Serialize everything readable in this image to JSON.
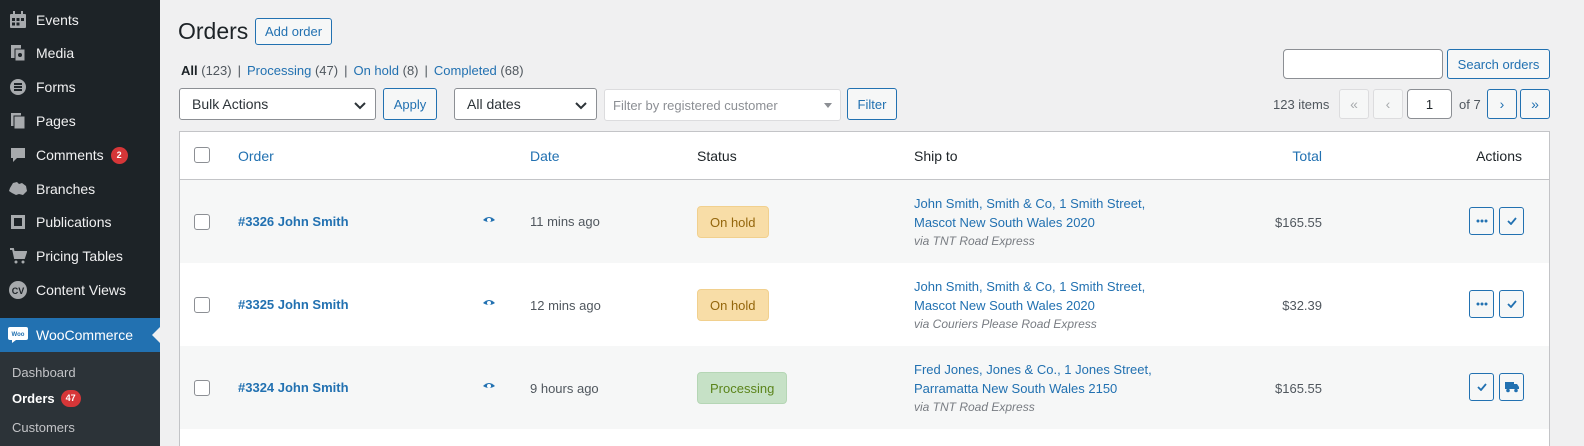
{
  "sidebar": {
    "items": [
      {
        "label": "Events",
        "icon": "calendar-icon"
      },
      {
        "label": "Media",
        "icon": "media-icon"
      },
      {
        "label": "Forms",
        "icon": "forms-icon"
      },
      {
        "label": "Pages",
        "icon": "pages-icon"
      },
      {
        "label": "Comments",
        "icon": "comments-icon",
        "badge": "2"
      },
      {
        "label": "Branches",
        "icon": "map-icon"
      },
      {
        "label": "Publications",
        "icon": "publications-icon"
      },
      {
        "label": "Pricing Tables",
        "icon": "cart-icon"
      },
      {
        "label": "Content Views",
        "icon": "cv-icon"
      }
    ],
    "woocommerce": {
      "label": "WooCommerce",
      "icon_text": "Woo"
    },
    "submenu": [
      {
        "label": "Dashboard"
      },
      {
        "label": "Orders",
        "badge": "47"
      },
      {
        "label": "Customers"
      }
    ]
  },
  "header": {
    "title": "Orders",
    "add_label": "Add order"
  },
  "views": [
    {
      "label": "All",
      "count": "(123)"
    },
    {
      "label": "Processing",
      "count": "(47)"
    },
    {
      "label": "On hold",
      "count": "(8)"
    },
    {
      "label": "Completed",
      "count": "(68)"
    }
  ],
  "filters": {
    "bulk_actions": "Bulk Actions",
    "apply_label": "Apply",
    "dates": "All dates",
    "customer_placeholder": "Filter by registered customer",
    "filter_label": "Filter"
  },
  "search": {
    "button_label": "Search orders"
  },
  "pagination": {
    "items": "123 items",
    "first": "«",
    "prev": "‹",
    "current": "1",
    "of": "of 7",
    "next": "›",
    "last": "»"
  },
  "table": {
    "headers": {
      "order": "Order",
      "date": "Date",
      "status": "Status",
      "ship_to": "Ship to",
      "total": "Total",
      "actions": "Actions"
    },
    "rows": [
      {
        "order": "#3326 John Smith",
        "date": "11 mins ago",
        "status": "On hold",
        "ship_line1": "John Smith, Smith & Co, 1 Smith Street,",
        "ship_line2": "Mascot New South Wales 2020",
        "via": "via TNT Road Express",
        "total": "$165.55"
      },
      {
        "order": "#3325 John Smith",
        "date": "12 mins ago",
        "status": "On hold",
        "ship_line1": "John Smith, Smith & Co, 1 Smith Street,",
        "ship_line2": "Mascot New South Wales 2020",
        "via": "via Couriers Please Road Express",
        "total": "$32.39"
      },
      {
        "order": "#3324 John Smith",
        "date": "9 hours ago",
        "status": "Processing",
        "ship_line1": "Fred Jones, Jones & Co., 1 Jones Street,",
        "ship_line2": "Parramatta New South Wales 2150",
        "via": "via TNT Road Express",
        "total": "$165.55"
      }
    ]
  },
  "colors": {
    "accent": "#2271b1",
    "sidebar_bg": "#1d2327",
    "on_hold_bg": "#f8dda7",
    "processing_bg": "#c6e1c6",
    "badge": "#d63638"
  }
}
